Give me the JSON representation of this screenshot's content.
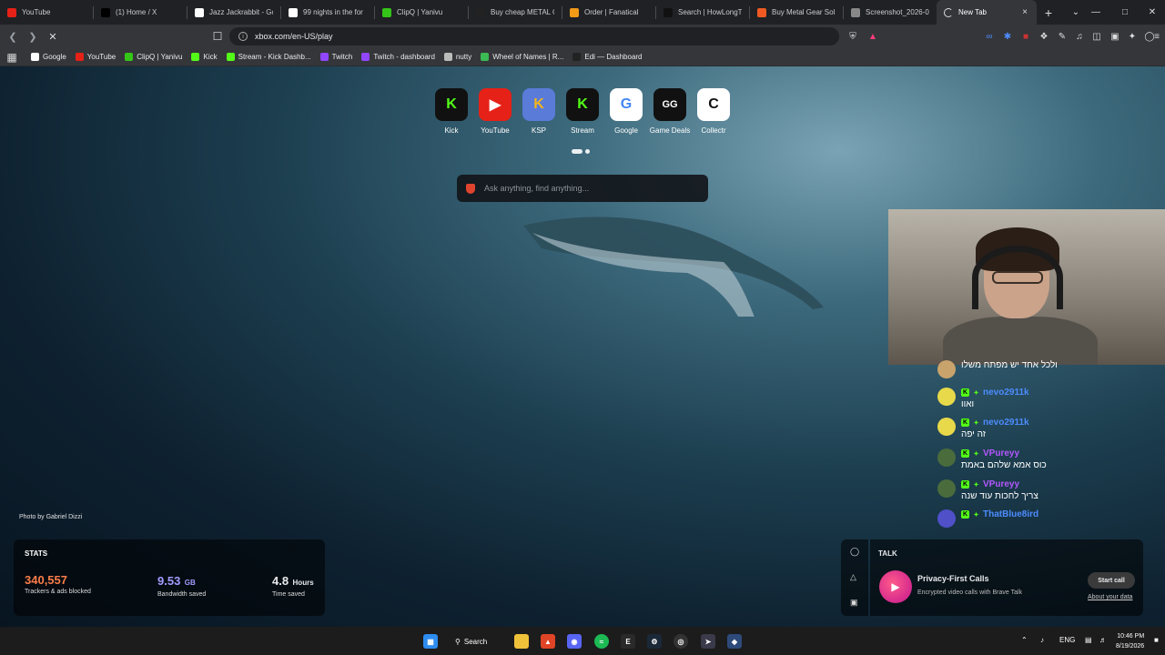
{
  "tabs": [
    {
      "label": "YouTube",
      "icon": "youtube-icon",
      "color": "#e62117"
    },
    {
      "label": "(1) Home / X",
      "icon": "x-icon",
      "color": "#000000"
    },
    {
      "label": "Jazz Jackrabbit - Go",
      "icon": "google-icon",
      "color": "#ffffff"
    },
    {
      "label": "99 nights in the for",
      "icon": "google-icon",
      "color": "#ffffff"
    },
    {
      "label": "ClipQ | Yanivu",
      "icon": "clipq-icon",
      "color": "#34c518"
    },
    {
      "label": "Buy cheap METAL G",
      "icon": "gg-icon",
      "color": "#222222"
    },
    {
      "label": "Order | Fanatical",
      "icon": "fanatical-icon",
      "color": "#f39a16"
    },
    {
      "label": "Search | HowLongT",
      "icon": "hltb-icon",
      "color": "#111111"
    },
    {
      "label": "Buy Metal Gear Sol",
      "icon": "g2a-icon",
      "color": "#f05a22"
    },
    {
      "label": "Screenshot_2026-0",
      "icon": "globe-icon",
      "color": "#888888"
    },
    {
      "label": "New Tab",
      "icon": "loading-icon",
      "color": "#35363a",
      "active": true
    }
  ],
  "address": "xbox.com/en-US/play",
  "bookmarks": [
    {
      "label": "Google",
      "icon": "google-icon",
      "color": "#ffffff"
    },
    {
      "label": "YouTube",
      "icon": "youtube-icon",
      "color": "#e62117"
    },
    {
      "label": "ClipQ | Yanivu",
      "icon": "clipq-icon",
      "color": "#34c518"
    },
    {
      "label": "Kick",
      "icon": "kick-icon",
      "color": "#53fc18"
    },
    {
      "label": "Stream - Kick Dashb...",
      "icon": "kick-icon",
      "color": "#53fc18"
    },
    {
      "label": "Twitch",
      "icon": "twitch-icon",
      "color": "#9146ff"
    },
    {
      "label": "Twitch - dashboard",
      "icon": "twitch-icon",
      "color": "#9146ff"
    },
    {
      "label": "nutty",
      "icon": "nutty-icon",
      "color": "#bbbbbb"
    },
    {
      "label": "Wheel of Names | R...",
      "icon": "wheel-icon",
      "color": "#3cba54"
    },
    {
      "label": "Edi — Dashboard",
      "icon": "edi-icon",
      "color": "#222222"
    }
  ],
  "top_sites": [
    {
      "label": "Kick",
      "glyph": "K",
      "color": "#53fc18",
      "bg": "#111111"
    },
    {
      "label": "YouTube",
      "glyph": "▶",
      "color": "#ffffff",
      "bg": "#e62117"
    },
    {
      "label": "KSP",
      "glyph": "K",
      "color": "#f2b51b",
      "bg": "#5a7bd8"
    },
    {
      "label": "Stream",
      "glyph": "K",
      "color": "#53fc18",
      "bg": "#111111"
    },
    {
      "label": "Google",
      "glyph": "G",
      "color": "#4285f4",
      "bg": "#ffffff"
    },
    {
      "label": "Game Deals",
      "glyph": "GG",
      "color": "#ffffff",
      "bg": "#111111"
    },
    {
      "label": "Collectr",
      "glyph": "C",
      "color": "#111111",
      "bg": "#ffffff"
    }
  ],
  "search_placeholder": "Ask anything, find anything...",
  "photo_credit": "Photo by Gabriel Dizzi",
  "stats": {
    "heading": "STATS",
    "trackers": {
      "value": "340,557",
      "label": "Trackers & ads blocked",
      "color": "#fb7d4a"
    },
    "bandwidth": {
      "value": "9.53",
      "unit": "GB",
      "label": "Bandwidth saved",
      "color": "#a59cff"
    },
    "time": {
      "value": "4.8",
      "unit": "Hours",
      "label": "Time saved",
      "color": "#ffffff"
    }
  },
  "chat": [
    {
      "user": "",
      "message": "ולכל אחד יש מפתח משלו",
      "avatar": "#c9a36c",
      "color": "#ffffff"
    },
    {
      "user": "nevo2911k",
      "message": "ואוו",
      "avatar": "#e8d94a",
      "color": "#4d8cff"
    },
    {
      "user": "nevo2911k",
      "message": "זה יפה",
      "avatar": "#e8d94a",
      "color": "#4d8cff"
    },
    {
      "user": "VPureyy",
      "message": "כוס אמא שלהם באמת",
      "avatar": "#4a6b3c",
      "color": "#b457ff"
    },
    {
      "user": "VPureyy",
      "message": "צריך לחכות עוד שנה",
      "avatar": "#4a6b3c",
      "color": "#b457ff"
    },
    {
      "user": "ThatBlue8ird",
      "message": "",
      "avatar": "#5050c8",
      "color": "#4d8cff"
    }
  ],
  "talk": {
    "heading": "TALK",
    "title": "Privacy-First Calls",
    "subtitle": "Encrypted video calls with Brave Talk",
    "button": "Start call",
    "link": "About your data"
  },
  "taskbar": {
    "search": "Search",
    "lang": "ENG",
    "time": "10:46 PM",
    "date": "8/19/2026"
  }
}
